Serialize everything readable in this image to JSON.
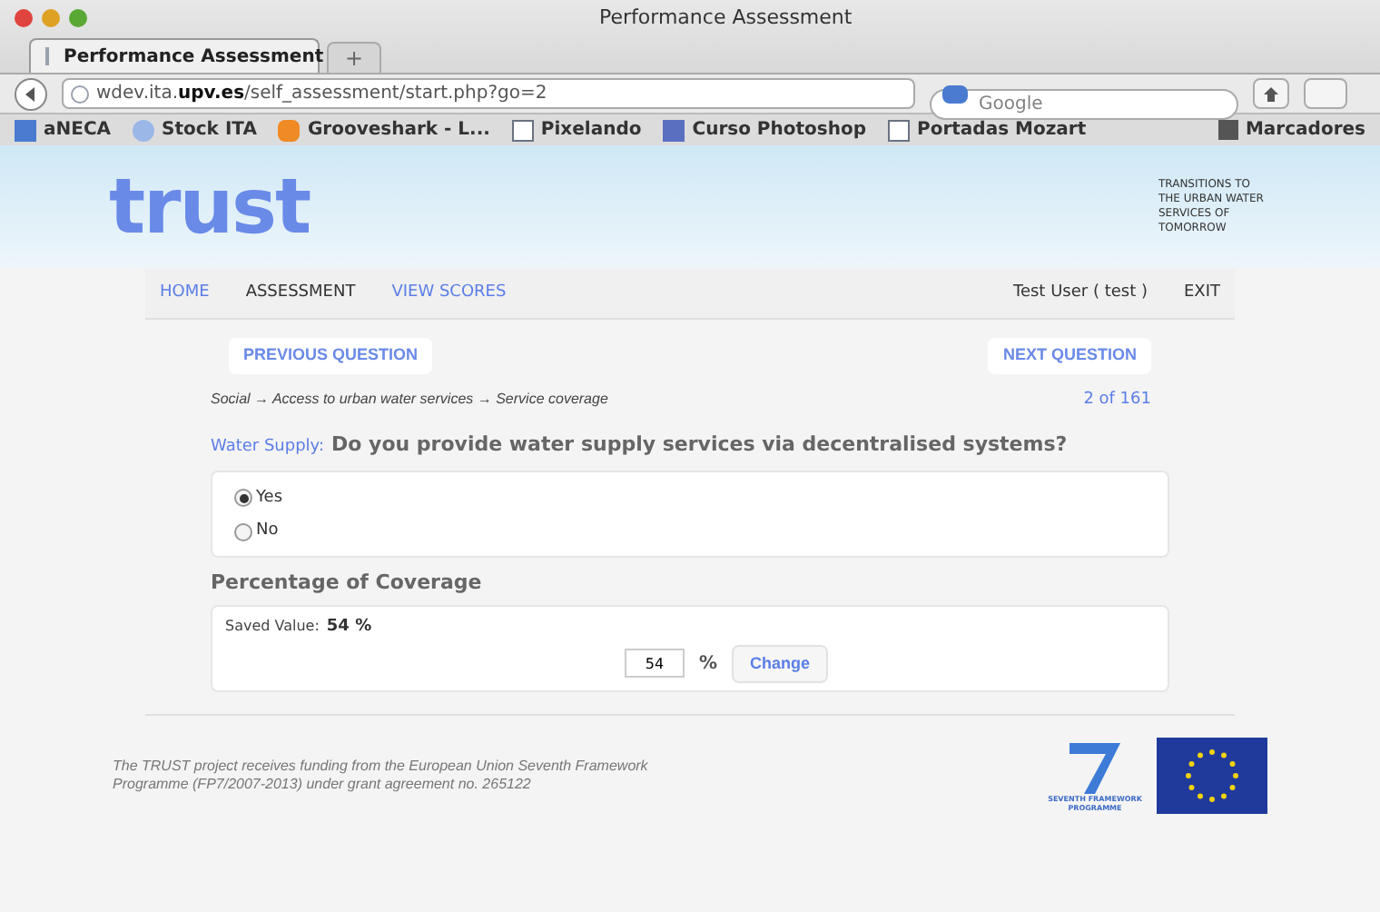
{
  "window": {
    "title": "Performance Assessment"
  },
  "tabs": [
    {
      "label": "Performance Assessment",
      "selected": true
    }
  ],
  "new_tab": "+",
  "address": {
    "prefix": "wdev.ita.",
    "domain": "upv.es",
    "path": "/self_assessment/start.php?go=2"
  },
  "search": {
    "placeholder": "Google"
  },
  "bookmarks": [
    "aNECA",
    "Stock ITA",
    "Grooveshark - L...",
    "Pixelando",
    "Curso Photoshop",
    "Portadas Mozart"
  ],
  "bookmarks_menu": "Marcadores",
  "site": {
    "logo": "trust",
    "tagline": "TRANSITIONS TO THE URBAN WATER SERVICES OF TOMORROW",
    "nav": [
      {
        "label": "HOME",
        "selected": false
      },
      {
        "label": "ASSESSMENT",
        "selected": true
      },
      {
        "label": "VIEW SCORES",
        "selected": false
      }
    ],
    "user": "Test User ( test )",
    "exit": "EXIT"
  },
  "previous_button": "PREVIOUS QUESTION",
  "next_button": "NEXT QUESTION",
  "breadcrumb": "Social → Access to urban water services → Service coverage",
  "counter": "2 of 161",
  "question": {
    "category": "Water Supply:",
    "text": "Do you provide water supply services via decentralised systems?",
    "options": [
      {
        "label": "Yes",
        "selected": true
      },
      {
        "label": "No",
        "selected": false
      }
    ]
  },
  "coverage": {
    "title": "Percentage of Coverage",
    "saved_label": "Saved Value:",
    "saved_value": "54 %",
    "value": "54",
    "unit": "%",
    "button": "Change"
  },
  "footer": {
    "text": "The TRUST project receives funding from the European Union Seventh Framework Programme (FP7/2007-2013) under grant agreement no. 265122",
    "fp7_caption": "SEVENTH FRAMEWORK PROGRAMME"
  }
}
